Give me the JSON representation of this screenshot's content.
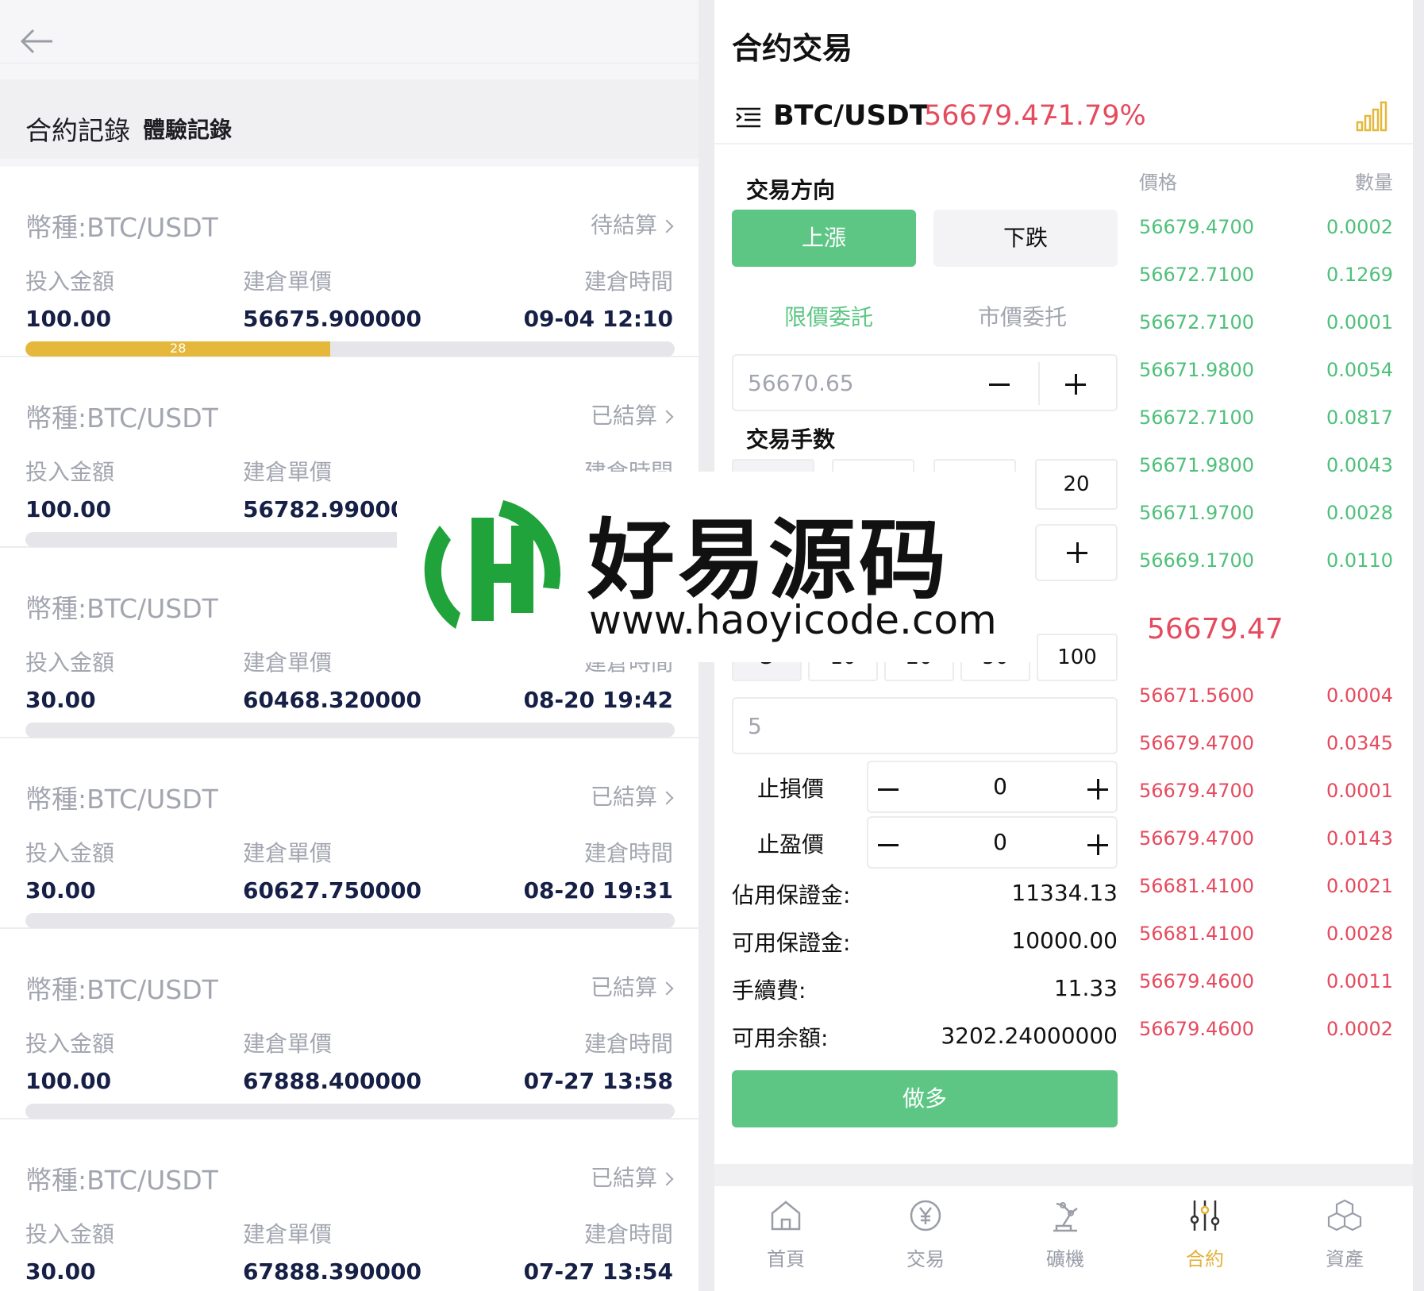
{
  "left": {
    "tab_main": "合約記錄",
    "tab_sub": "體驗記錄",
    "records": [
      {
        "coin": "幣種:BTC/USDT",
        "status": "待結算",
        "amount_label": "投入金額",
        "price_label": "建倉單價",
        "time_label": "建倉時間",
        "amount": "100.00",
        "price": "56675.900000",
        "time": "09-04 12:10",
        "progress": 0.47,
        "countdown": "28"
      },
      {
        "coin": "幣種:BTC/USDT",
        "status": "已結算",
        "amount_label": "投入金額",
        "price_label": "建倉單價",
        "time_label": "建倉時間",
        "amount": "100.00",
        "price": "56782.990000",
        "time": "",
        "progress": 0,
        "countdown": ""
      },
      {
        "coin": "幣種:BTC/USDT",
        "status": "",
        "amount_label": "投入金額",
        "price_label": "建倉單價",
        "time_label": "建倉時間",
        "amount": "30.00",
        "price": "60468.320000",
        "time": "08-20 19:42",
        "progress": 0,
        "countdown": ""
      },
      {
        "coin": "幣種:BTC/USDT",
        "status": "已結算",
        "amount_label": "投入金額",
        "price_label": "建倉單價",
        "time_label": "建倉時間",
        "amount": "30.00",
        "price": "60627.750000",
        "time": "08-20 19:31",
        "progress": 0,
        "countdown": ""
      },
      {
        "coin": "幣種:BTC/USDT",
        "status": "已結算",
        "amount_label": "投入金額",
        "price_label": "建倉單價",
        "time_label": "建倉時間",
        "amount": "100.00",
        "price": "67888.400000",
        "time": "07-27 13:58",
        "progress": 0,
        "countdown": ""
      },
      {
        "coin": "幣種:BTC/USDT",
        "status": "已結算",
        "amount_label": "投入金額",
        "price_label": "建倉單價",
        "time_label": "建倉時間",
        "amount": "30.00",
        "price": "67888.390000",
        "time": "07-27 13:54",
        "progress": 0,
        "countdown": ""
      }
    ]
  },
  "right": {
    "title": "合约交易",
    "pair": "BTC/USDT",
    "last_price": "56679.47",
    "change": "-1.79%",
    "direction_label": "交易方向",
    "up_label": "上漲",
    "down_label": "下跌",
    "limit_label": "限價委託",
    "market_label": "市價委托",
    "price_input": "56670.65",
    "lots_label": "交易手数",
    "lots_row1": [
      "",
      "",
      "",
      "20"
    ],
    "lots_row2": [
      "5",
      "10",
      "20",
      "50",
      "100"
    ],
    "lots_input": "5",
    "stop_loss_label": "止損價",
    "stop_loss_value": "0",
    "take_profit_label": "止盈價",
    "take_profit_value": "0",
    "margin_used_label": "佔用保證金:",
    "margin_used": "11334.13",
    "margin_avail_label": "可用保證金:",
    "margin_avail": "10000.00",
    "fee_label": "手續費:",
    "fee": "11.33",
    "balance_label": "可用余額:",
    "balance": "3202.24000000",
    "long_button": "做多",
    "orderbook": {
      "price_header": "價格",
      "qty_header": "數量",
      "bids": [
        {
          "price": "56679.4700",
          "qty": "0.0002"
        },
        {
          "price": "56672.7100",
          "qty": "0.1269"
        },
        {
          "price": "56672.7100",
          "qty": "0.0001"
        },
        {
          "price": "56671.9800",
          "qty": "0.0054"
        },
        {
          "price": "56672.7100",
          "qty": "0.0817"
        },
        {
          "price": "56671.9800",
          "qty": "0.0043"
        },
        {
          "price": "56671.9700",
          "qty": "0.0028"
        },
        {
          "price": "56669.1700",
          "qty": "0.0110"
        }
      ],
      "mid_price": "56679.47",
      "asks": [
        {
          "price": "56671.5600",
          "qty": "0.0004"
        },
        {
          "price": "56679.4700",
          "qty": "0.0345"
        },
        {
          "price": "56679.4700",
          "qty": "0.0001"
        },
        {
          "price": "56679.4700",
          "qty": "0.0143"
        },
        {
          "price": "56681.4100",
          "qty": "0.0021"
        },
        {
          "price": "56681.4100",
          "qty": "0.0028"
        },
        {
          "price": "56679.4600",
          "qty": "0.0011"
        },
        {
          "price": "56679.4600",
          "qty": "0.0002"
        }
      ]
    },
    "nav": [
      {
        "label": "首頁",
        "icon": "home-icon"
      },
      {
        "label": "交易",
        "icon": "yen-icon"
      },
      {
        "label": "礦機",
        "icon": "robot-arm-icon"
      },
      {
        "label": "合約",
        "icon": "sliders-icon"
      },
      {
        "label": "資產",
        "icon": "cubes-icon"
      }
    ],
    "nav_active": "合約"
  },
  "watermark": {
    "title": "好易源码",
    "url": "www.haoyicode.com"
  },
  "colors": {
    "green": "#5dc684",
    "red": "#e54b5e",
    "gold": "#e5b73b",
    "navy": "#161f45"
  }
}
